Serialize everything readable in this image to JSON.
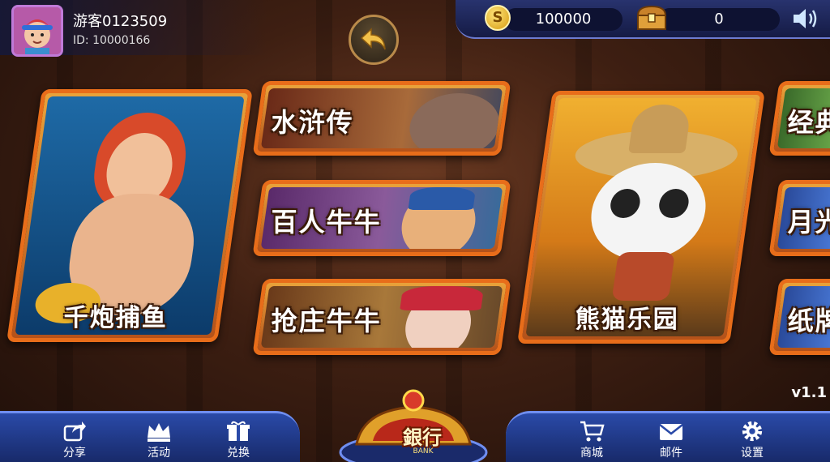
{
  "user": {
    "name": "游客0123509",
    "id_text": "ID: 10000166"
  },
  "wallet": {
    "coins": "100000",
    "bank": "0"
  },
  "games": {
    "fishing": "千炮捕鱼",
    "water_margin": "水浒传",
    "hundred_niuniu": "百人牛牛",
    "grab_banker_niuniu": "抢庄牛牛",
    "panda_paradise": "熊猫乐园",
    "classic": "经典",
    "moonlight": "月光",
    "paper_cards": "纸牌"
  },
  "nav": {
    "share": "分享",
    "activity": "活动",
    "exchange": "兑换",
    "shop": "商城",
    "mail": "邮件",
    "settings": "设置"
  },
  "bank_button": {
    "label": "銀行",
    "sub": "BANK"
  },
  "version": "v1.1",
  "icons": [
    "avatar",
    "back-arrow-icon",
    "coin-icon",
    "treasure-chest-icon",
    "speaker-icon",
    "share-icon",
    "crown-icon",
    "gift-icon",
    "cart-icon",
    "mail-icon",
    "gear-icon"
  ],
  "colors": {
    "accent": "#e86d1a",
    "nav_blue": "#2a4aa8",
    "gold": "#f2c14a"
  }
}
